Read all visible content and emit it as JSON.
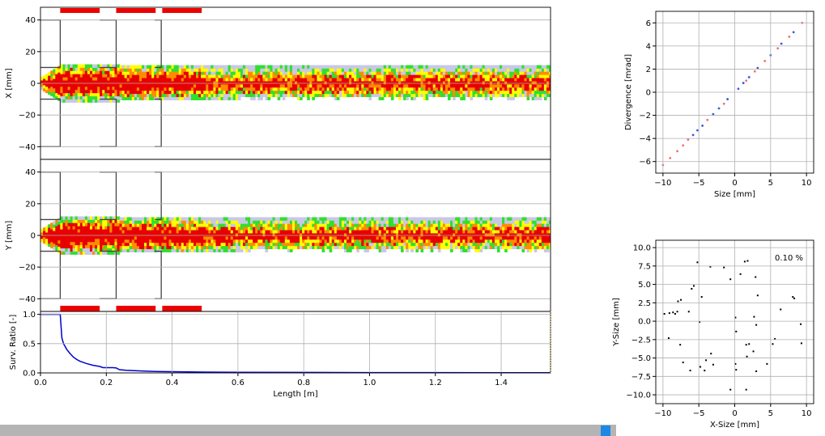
{
  "colors": {
    "hot": "#e80000",
    "orange": "#ff8c00",
    "yellow": "#ffff00",
    "green": "#2fe02f",
    "lavender": "#c8c8e6",
    "magnet": "#ee0000",
    "aperture": "#444444",
    "survival_line": "#0000cc",
    "phase_blue": "#3c5adc",
    "phase_red": "#f07070",
    "grid": "#b0b0b0",
    "scroll_thumb": "#1e88e5"
  },
  "chart_data": [
    {
      "id": "x-profile",
      "type": "heatmap",
      "title": "",
      "xlabel": "",
      "ylabel": "X [mm]",
      "xlim": [
        0,
        1.55
      ],
      "ylim": [
        -48,
        48
      ],
      "yticks": [
        "40",
        "20",
        "0",
        "−20",
        "−40"
      ],
      "ytick_values": [
        40,
        20,
        0,
        -20,
        -40
      ],
      "grid": true,
      "apertures": [
        {
          "s_start": 0.0,
          "s_end": 0.06,
          "half_width": 40
        },
        {
          "s_start": 0.18,
          "s_end": 0.23,
          "half_width": 40
        },
        {
          "s_start": 0.347,
          "s_end": 0.367,
          "half_width": 40
        }
      ],
      "inner_half_width": 10,
      "magnets": [
        {
          "s_start": 0.06,
          "s_end": 0.18
        },
        {
          "s_start": 0.23,
          "s_end": 0.35
        },
        {
          "s_start": 0.37,
          "s_end": 0.49
        }
      ],
      "beam_envelope_half_width_mm": 10,
      "color_scale": [
        "lavender",
        "green",
        "yellow",
        "orange",
        "hot"
      ]
    },
    {
      "id": "y-profile",
      "type": "heatmap",
      "title": "",
      "xlabel": "",
      "ylabel": "Y [mm]",
      "xlim": [
        0,
        1.55
      ],
      "ylim": [
        -48,
        48
      ],
      "yticks": [
        "40",
        "20",
        "0",
        "−20",
        "−40"
      ],
      "ytick_values": [
        40,
        20,
        0,
        -20,
        -40
      ],
      "grid": true,
      "apertures": [
        {
          "s_start": 0.0,
          "s_end": 0.06,
          "half_width": 40
        },
        {
          "s_start": 0.18,
          "s_end": 0.23,
          "half_width": 40
        },
        {
          "s_start": 0.347,
          "s_end": 0.367,
          "half_width": 40
        }
      ],
      "inner_half_width": 10,
      "magnets": [
        {
          "s_start": 0.06,
          "s_end": 0.18
        },
        {
          "s_start": 0.23,
          "s_end": 0.35
        },
        {
          "s_start": 0.37,
          "s_end": 0.49
        }
      ],
      "beam_envelope_half_width_mm": 10,
      "color_scale": [
        "lavender",
        "green",
        "yellow",
        "orange",
        "hot"
      ]
    },
    {
      "id": "survival",
      "type": "line",
      "title": "",
      "xlabel": "Length [m]",
      "ylabel": "Surv. Ratio [-]",
      "xlim": [
        0,
        1.55
      ],
      "ylim": [
        0,
        1.05
      ],
      "xticks": [
        "0.0",
        "0.2",
        "0.4",
        "0.6",
        "0.8",
        "1.0",
        "1.2",
        "1.4"
      ],
      "xtick_values": [
        0,
        0.2,
        0.4,
        0.6,
        0.8,
        1.0,
        1.2,
        1.4
      ],
      "yticks": [
        "0.0",
        "0.5",
        "1.0"
      ],
      "ytick_values": [
        0,
        0.5,
        1.0
      ],
      "grid": true,
      "series": [
        {
          "x": [
            0,
            0.06,
            0.065,
            0.07,
            0.08,
            0.09,
            0.1,
            0.11,
            0.12,
            0.14,
            0.16,
            0.18,
            0.19,
            0.22,
            0.23,
            0.24,
            0.26,
            0.3,
            0.35,
            0.4,
            0.5,
            0.6,
            0.8,
            1.0,
            1.2,
            1.4,
            1.55
          ],
          "y": [
            1.0,
            1.0,
            0.6,
            0.5,
            0.4,
            0.33,
            0.27,
            0.23,
            0.2,
            0.16,
            0.13,
            0.11,
            0.09,
            0.09,
            0.085,
            0.055,
            0.045,
            0.035,
            0.025,
            0.02,
            0.014,
            0.01,
            0.008,
            0.006,
            0.005,
            0.004,
            0.004
          ]
        }
      ]
    },
    {
      "id": "phase-space",
      "type": "scatter",
      "title": "",
      "xlabel": "Size [mm]",
      "ylabel": "Divergence [mrad]",
      "xlim": [
        -11,
        11
      ],
      "ylim": [
        -7,
        7
      ],
      "xticks": [
        "−10",
        "−5",
        "0",
        "5",
        "10"
      ],
      "xtick_values": [
        -10,
        -5,
        0,
        5,
        10
      ],
      "yticks": [
        "6",
        "4",
        "2",
        "0",
        "−2",
        "−4",
        "−6"
      ],
      "ytick_values": [
        6,
        4,
        2,
        0,
        -2,
        -4,
        -6
      ],
      "grid": true,
      "series": [
        {
          "x": [
            -5.8,
            -5.2,
            -4.5,
            -3.0,
            -2.2,
            -1.0,
            0.5,
            1.2,
            2.0,
            3.2,
            5.0,
            6.5,
            8.2
          ],
          "y": [
            -3.7,
            -3.3,
            -2.9,
            -1.9,
            -1.4,
            -0.6,
            0.3,
            0.8,
            1.3,
            2.1,
            3.2,
            4.2,
            5.2
          ]
        },
        {
          "x": [
            -10.0,
            -9.0,
            -8.0,
            -7.2,
            -6.5,
            -3.8,
            -1.5,
            1.6,
            2.8,
            4.2,
            6.0,
            7.6,
            9.4
          ],
          "y": [
            -6.3,
            -5.7,
            -5.1,
            -4.6,
            -4.1,
            -2.4,
            -1.0,
            1.0,
            1.8,
            2.7,
            3.8,
            4.8,
            6.0
          ]
        }
      ]
    },
    {
      "id": "transverse",
      "type": "scatter",
      "title": "",
      "annotation": "0.10 %",
      "xlabel": "X-Size [mm]",
      "ylabel": "Y-Size [mm]",
      "xlim": [
        -11,
        11
      ],
      "ylim": [
        -11.2,
        11
      ],
      "xticks": [
        "−10",
        "−5",
        "0",
        "5",
        "10"
      ],
      "xtick_values": [
        -10,
        -5,
        0,
        5,
        10
      ],
      "yticks": [
        "10.0",
        "7.5",
        "5.0",
        "2.5",
        "0.0",
        "−2.5",
        "−5.0",
        "−7.5",
        "−10.0"
      ],
      "ytick_values": [
        10,
        7.5,
        5,
        2.5,
        0,
        -2.5,
        -5,
        -7.5,
        -10
      ],
      "grid": true,
      "series": [
        {
          "x": [
            -9.8,
            -9.1,
            -8.6,
            -8.3,
            -7.9,
            -7.5,
            -7.6,
            -7.2,
            -6.4,
            -8.0,
            -6.0,
            -5.7,
            -5.2,
            -4.9,
            -4.6,
            -3.4,
            -4.2,
            -3.0,
            -4.0,
            -3.3,
            -4.8,
            -9.2,
            -6.2,
            -1.5,
            -0.6,
            0.8,
            1.4,
            1.8,
            2.9,
            3.2,
            2.7,
            3.0,
            0.1,
            0.2,
            0.1,
            0.2,
            1.6,
            2.0,
            1.7,
            2.6,
            3.0,
            4.5,
            5.3,
            5.6,
            6.4,
            8.1,
            8.3,
            9.2,
            9.3,
            -0.6,
            1.6
          ],
          "y": [
            1.0,
            1.1,
            1.2,
            1.0,
            2.7,
            2.9,
            -3.2,
            -5.6,
            1.3,
            1.3,
            4.4,
            4.8,
            8.0,
            -0.1,
            3.3,
            7.4,
            -6.7,
            -5.9,
            -5.3,
            -4.4,
            -6.2,
            -2.3,
            -6.7,
            7.3,
            5.7,
            6.4,
            8.1,
            8.2,
            6.0,
            3.5,
            0.6,
            -0.5,
            0.5,
            -1.4,
            -5.8,
            -6.6,
            -3.2,
            -3.1,
            -4.8,
            -4.1,
            -6.8,
            -5.8,
            -3.1,
            -2.4,
            1.6,
            3.3,
            3.1,
            -0.4,
            -3.0,
            -9.3,
            -9.3
          ]
        }
      ]
    }
  ]
}
